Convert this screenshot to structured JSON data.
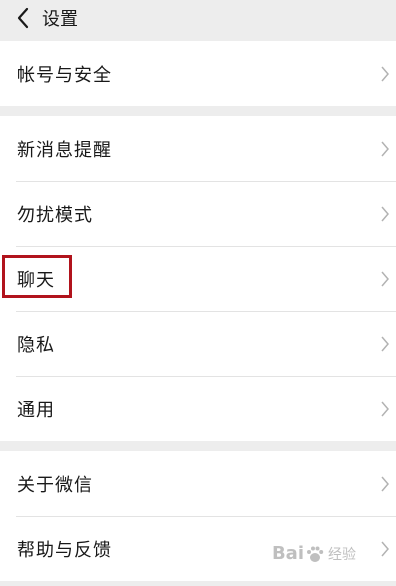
{
  "header": {
    "title": "设置",
    "back_icon": "chevron-left-icon"
  },
  "groups": [
    {
      "items": [
        {
          "label": "帐号与安全"
        }
      ]
    },
    {
      "items": [
        {
          "label": "新消息提醒"
        },
        {
          "label": "勿扰模式"
        },
        {
          "label": "聊天"
        },
        {
          "label": "隐私"
        },
        {
          "label": "通用"
        }
      ]
    },
    {
      "items": [
        {
          "label": "关于微信"
        },
        {
          "label": "帮助与反馈"
        }
      ]
    }
  ],
  "watermark": {
    "text_prefix": "Bai",
    "text_suffix": "经验"
  },
  "colors": {
    "background": "#ededed",
    "row_background": "#ffffff",
    "highlight_border": "#b1131c",
    "chevron": "#b2b2b2"
  }
}
